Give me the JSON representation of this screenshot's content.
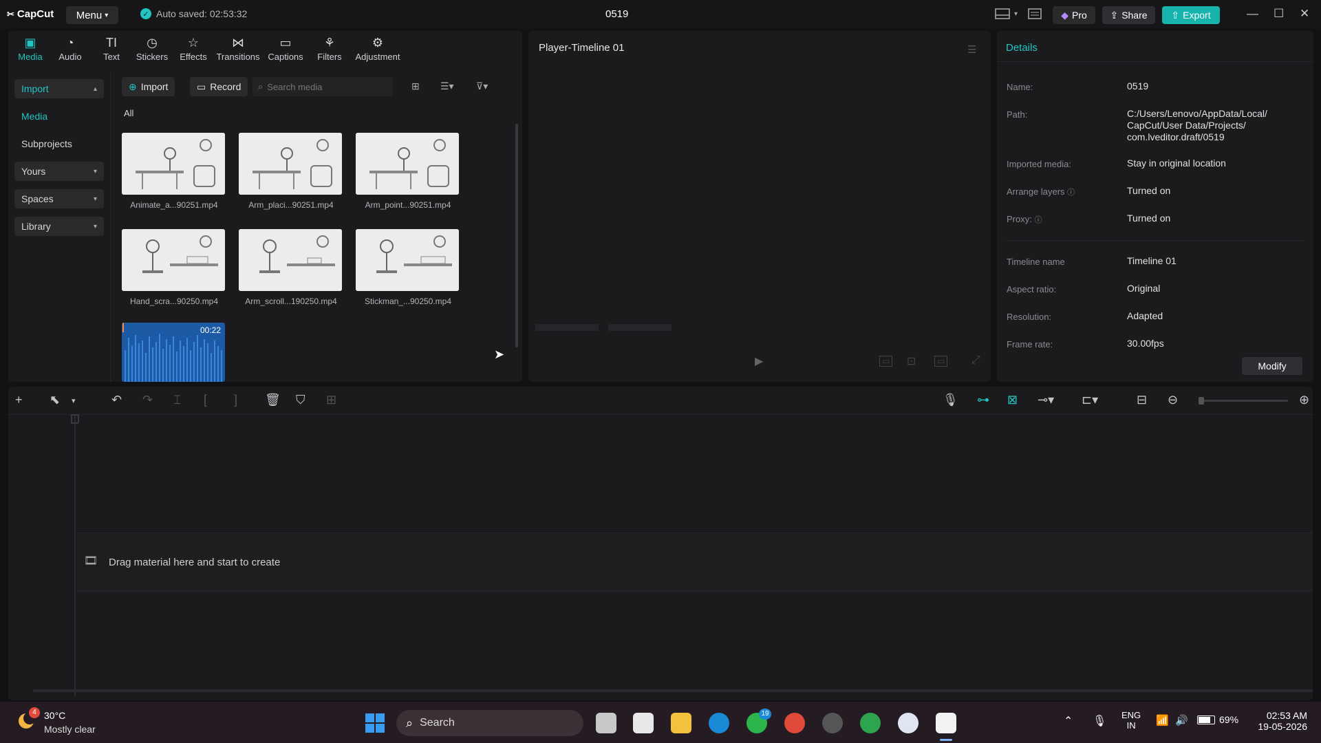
{
  "titlebar": {
    "app_name": "CapCut",
    "menu_label": "Menu",
    "autosave": "Auto saved: 02:53:32",
    "project_title": "0519",
    "pro_label": "Pro",
    "share_label": "Share",
    "export_label": "Export"
  },
  "toolbar": {
    "tabs": [
      {
        "label": "Media"
      },
      {
        "label": "Audio"
      },
      {
        "label": "Text"
      },
      {
        "label": "Stickers"
      },
      {
        "label": "Effects"
      },
      {
        "label": "Transitions"
      },
      {
        "label": "Captions"
      },
      {
        "label": "Filters"
      },
      {
        "label": "Adjustment"
      }
    ]
  },
  "sidebar": {
    "items": [
      {
        "label": "Import"
      },
      {
        "label": "Media"
      },
      {
        "label": "Subprojects"
      },
      {
        "label": "Yours"
      },
      {
        "label": "Spaces"
      },
      {
        "label": "Library"
      }
    ]
  },
  "media": {
    "import_label": "Import",
    "record_label": "Record",
    "search_placeholder": "Search media",
    "filter_all": "All",
    "files": [
      {
        "name": "Animate_a...90251.mp4"
      },
      {
        "name": "Arm_placi...90251.mp4"
      },
      {
        "name": "Arm_point...90251.mp4"
      },
      {
        "name": "Hand_scra...90250.mp4"
      },
      {
        "name": "Arm_scroll...190250.mp4"
      },
      {
        "name": "Stickman_...90250.mp4"
      }
    ],
    "audio_duration": "00:22"
  },
  "player": {
    "title": "Player-Timeline 01"
  },
  "details": {
    "title": "Details",
    "rows": [
      {
        "label": "Name:",
        "value": "0519"
      },
      {
        "label": "Path:",
        "value": "C:/Users/Lenovo/AppData/Local/ CapCut/User Data/Projects/ com.lveditor.draft/0519"
      },
      {
        "label": "Imported media:",
        "value": "Stay in original location"
      },
      {
        "label": "Arrange layers",
        "value": "Turned on"
      },
      {
        "label": "Proxy:",
        "value": "Turned on"
      },
      {
        "label": "Timeline name",
        "value": "Timeline 01"
      },
      {
        "label": "Aspect ratio:",
        "value": "Original"
      },
      {
        "label": "Resolution:",
        "value": "Adapted"
      },
      {
        "label": "Frame rate:",
        "value": "30.00fps"
      }
    ],
    "modify_label": "Modify"
  },
  "timeline": {
    "drop_text": "Drag material here and start to create"
  },
  "taskbar": {
    "weather_temp": "30°C",
    "weather_desc": "Mostly clear",
    "search_label": "Search",
    "lang_top": "ENG",
    "lang_bottom": "IN",
    "battery": "69%",
    "time": "02:53 AM",
    "date": "19-05-2026",
    "whatsapp_badge": "19",
    "weather_badge": "4"
  },
  "colors": {
    "accent": "#21c5c1",
    "panel": "#1b1b1e",
    "background": "#121214"
  }
}
